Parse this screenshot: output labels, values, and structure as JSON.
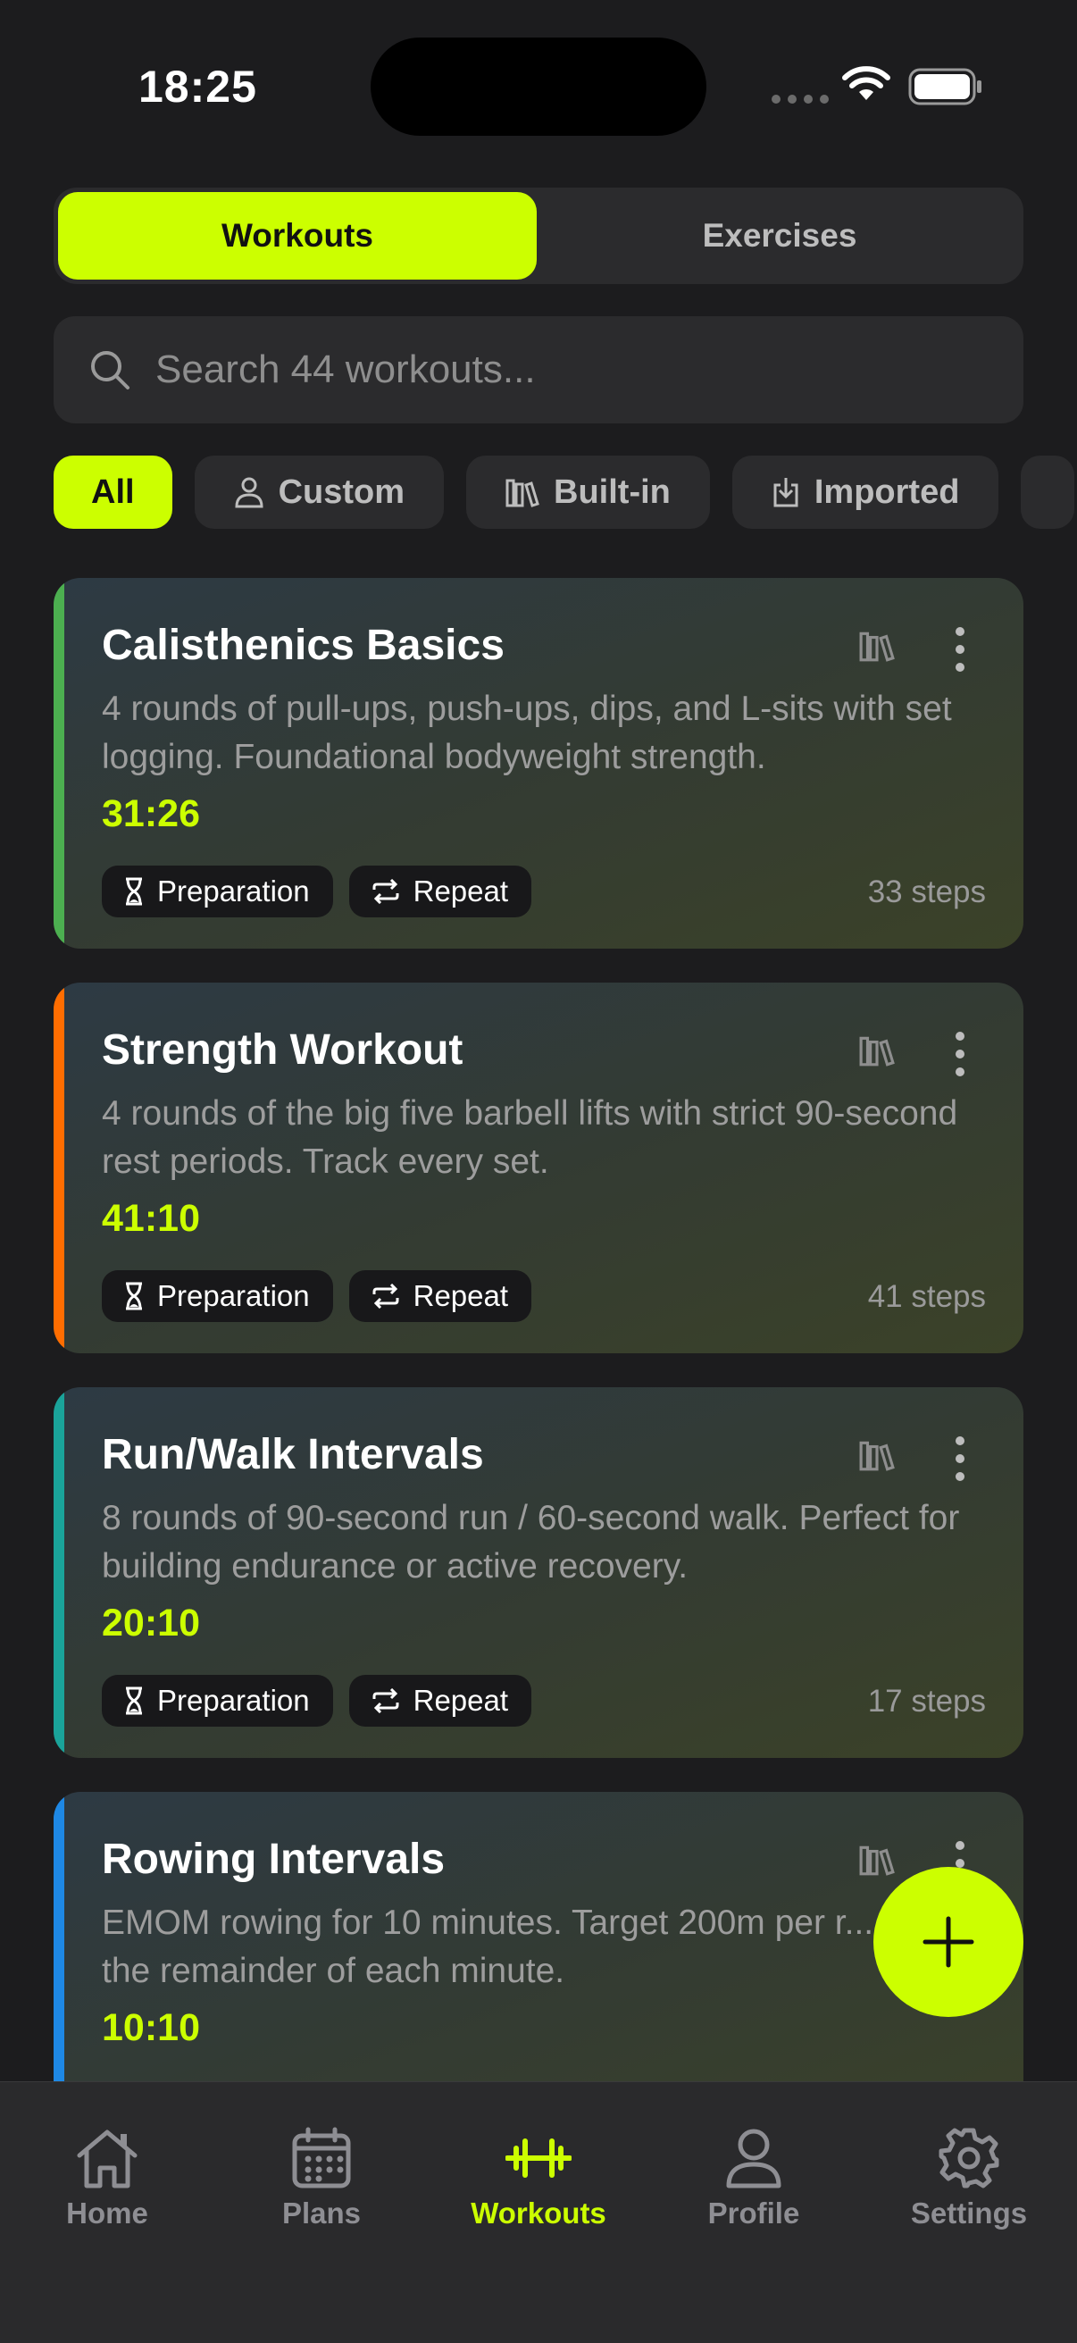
{
  "status_bar": {
    "time": "18:25"
  },
  "segment": {
    "active_label": "Workouts",
    "inactive_label": "Exercises"
  },
  "search": {
    "placeholder": "Search 44 workouts..."
  },
  "filters": [
    {
      "label": "All",
      "icon": "none",
      "active": true
    },
    {
      "label": "Custom",
      "icon": "person-icon",
      "active": false
    },
    {
      "label": "Built-in",
      "icon": "library-icon",
      "active": false
    },
    {
      "label": "Imported",
      "icon": "import-icon",
      "active": false
    }
  ],
  "workouts": [
    {
      "title": "Calisthenics Basics",
      "description": "4 rounds of pull-ups, push-ups, dips, and L-sits with set logging. Foundational bodyweight strength.",
      "duration": "31:26",
      "tags": [
        "Preparation",
        "Repeat"
      ],
      "steps": "33 steps",
      "accent": "#4caf50"
    },
    {
      "title": "Strength Workout",
      "description": "4 rounds of the big five barbell lifts with strict 90-second rest periods. Track every set.",
      "duration": "41:10",
      "tags": [
        "Preparation",
        "Repeat"
      ],
      "steps": "41 steps",
      "accent": "#ff6d00"
    },
    {
      "title": "Run/Walk Intervals",
      "description": "8 rounds of 90-second run / 60-second walk. Perfect for building endurance or active recovery.",
      "duration": "20:10",
      "tags": [
        "Preparation",
        "Repeat"
      ],
      "steps": "17 steps",
      "accent": "#1aa39a"
    },
    {
      "title": "Rowing Intervals",
      "description": "EMOM rowing for 10 minutes. Target 200m per r... rest the remainder of each minute.",
      "duration": "10:10",
      "tags": [],
      "steps": "",
      "accent": "#1e88e5"
    }
  ],
  "tabbar": [
    {
      "label": "Home",
      "icon": "home-icon",
      "active": false
    },
    {
      "label": "Plans",
      "icon": "calendar-icon",
      "active": false
    },
    {
      "label": "Workouts",
      "icon": "dumbbell-icon",
      "active": true
    },
    {
      "label": "Profile",
      "icon": "person-icon",
      "active": false
    },
    {
      "label": "Settings",
      "icon": "gear-icon",
      "active": false
    }
  ],
  "colors": {
    "accent": "#ccff00",
    "background": "#1c1c1e",
    "surface": "#2b2b2d"
  }
}
